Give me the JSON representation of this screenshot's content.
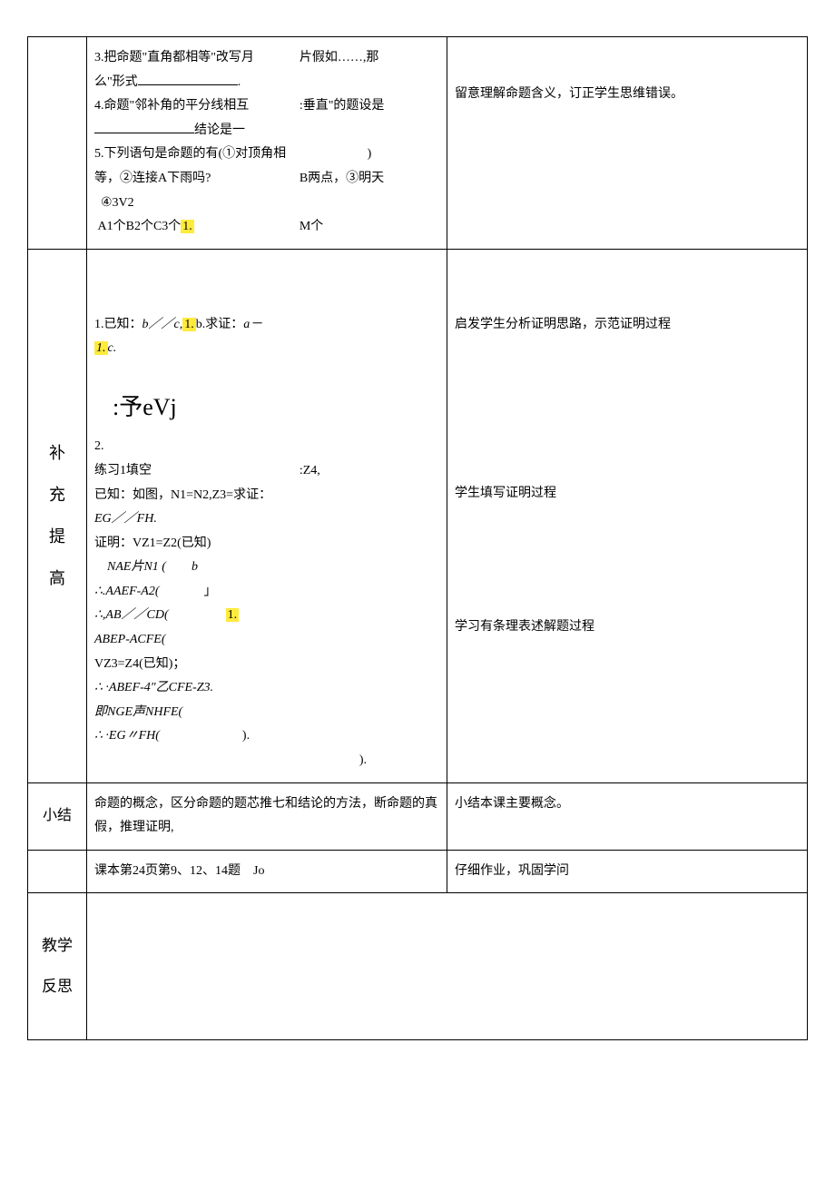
{
  "row1": {
    "mid": {
      "q3_a": "3.把命题\"直角都相等\"改写月",
      "q3_b": "片假如……,那",
      "q3_c": "么\"形式",
      "q4_a": "4.命题\"邻补角的平分线相互",
      "q4_b": ":垂直\"的题设是",
      "q4_c": "结论是一",
      "q5_a": "5.下列语句是命题的有(①对顶角相等，②连接A下雨吗?",
      "q5_b": ")",
      "q5_c": "B两点，③明天",
      "q5_d": "④3V2",
      "q5_e": "A1个B2个C3个",
      "q5_f": "1.",
      "q5_g": "M个"
    },
    "right": "留意理解命题含义，订正学生思维错误。"
  },
  "row2": {
    "label_chars": [
      "补",
      "充",
      "提",
      "高"
    ],
    "mid": {
      "p1_a": "1.已知：",
      "p1_b": "b／／c,",
      "p1_c": "1.",
      "p1_d": "b.求证：",
      "p1_e": "a－",
      "p1_f": "1.",
      "p1_g": "c.",
      "sketch": ":予eVj",
      "p2": "2.",
      "ex_a": "练习1填空",
      "ex_b": ":Z4,",
      "ex_c": "已知：如图，N1=N2,Z3=求证：",
      "ex_d": "EG／／FH.",
      "ex_e": "证明：VZ1=Z2(已知)",
      "ex_f": "NAE",
      "ex_f2": "片",
      "ex_f3": "N1 (",
      "ex_f4": "b",
      "ex_g": "∴.AAEF-A2(",
      "ex_g2": "」",
      "ex_h": "∴,AB／／CD(",
      "ex_h2": "1.",
      "ex_i": "ABEP-ACFE(",
      "ex_j": "VZ3=Z4(已知)；",
      "ex_k": "∴ ·ABEF-4\"乙CFE-Z3.",
      "ex_l": "即NGE声NHFE(",
      "ex_m": "∴ ·EG〃FH(",
      "ex_m2": ").",
      "ex_n": ")."
    },
    "right": {
      "r1": "启发学生分析证明思路，示范证明过程",
      "r2": "学生填写证明过程",
      "r3": "学习有条理表述解题过程"
    }
  },
  "row3": {
    "label": "小结",
    "mid": "命题的概念，区分命题的题芯推七和结论的方法，小结本课主要概念。断命题的真假，推理证明,",
    "mid_a": "命题的概念，区分命题的题芯推七和结论的方法，断命题的真假，推理证明,",
    "mid_b": "Jo",
    "right": "小结本课主要概念。"
  },
  "row4": {
    "mid": "课本第24页第9、12、14题",
    "right": "仔细作业，巩固学问"
  },
  "row5": {
    "label_chars": [
      "教学",
      "反思"
    ]
  }
}
